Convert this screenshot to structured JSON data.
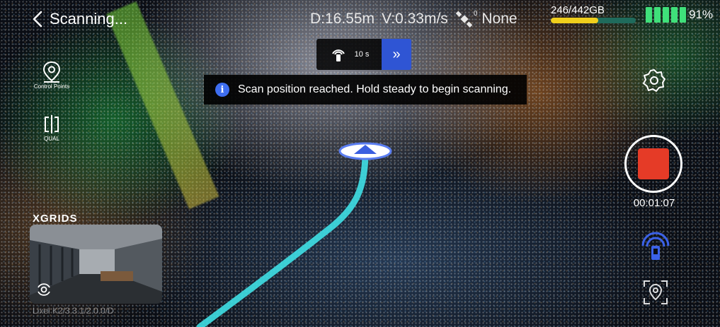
{
  "header": {
    "back_label": "Scanning...",
    "distance": "D:16.55m",
    "velocity": "V:0.33m/s",
    "satellite_count": "0",
    "satellite_status": "None",
    "storage_text": "246/442GB",
    "storage_fraction": 0.557,
    "battery_text": "91%",
    "battery_level": 0.91
  },
  "timer": {
    "countdown": "10 s",
    "skip_glyph": "»"
  },
  "toast": {
    "info_glyph": "i",
    "message": "Scan position reached. Hold steady to begin scanning."
  },
  "tools": {
    "control_points_label": "Control Points",
    "qual_label": "QUAL"
  },
  "preview": {
    "brand": "XGRIDS",
    "version": "Lixel K2/3.3.1/2.0.0/D"
  },
  "recording": {
    "elapsed": "00:01:07"
  },
  "colors": {
    "accent_blue": "#2f55d4",
    "record_red": "#e53b27",
    "battery_green": "#3fe07a",
    "storage_yellow": "#f0cf1c",
    "trail_cyan": "#3fe0e6"
  },
  "icons": {
    "back": "chevron-left-icon",
    "satellite": "satellite-icon",
    "scan_signal": "scan-signal-icon",
    "info": "info-icon",
    "control_points": "map-pin-icon",
    "qual": "qual-icon",
    "rotate_camera": "rotate-camera-icon",
    "settings": "gear-icon",
    "location": "location-marker-icon"
  }
}
